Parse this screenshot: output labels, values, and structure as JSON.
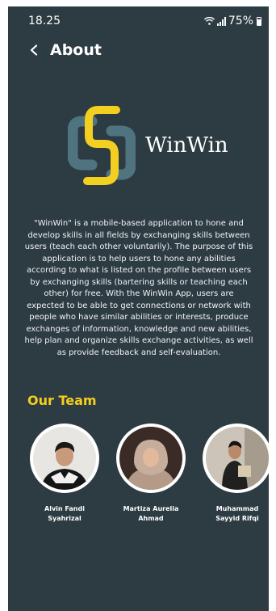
{
  "status": {
    "time": "18.25",
    "battery": "75%"
  },
  "header": {
    "title": "About"
  },
  "brand": {
    "name": "WinWin",
    "colors": {
      "yellow": "#f2cf20",
      "teal": "#4f7480",
      "background": "#2d3b43"
    }
  },
  "about": {
    "text": "\"WinWin\" is a mobile-based application to hone and develop skills in all fields by exchanging skills between users (teach each other voluntarily). The purpose of this application is to help users to hone any abilities according to what is listed on the profile between users by exchanging skills (bartering skills or teaching each other) for free. With the WinWin App, users are expected to be able to get connections or network with people who have similar abilities or interests, produce exchanges of information, knowledge and new abilities, help plan and organize skills exchange activities, as well as provide feedback and self-evaluation."
  },
  "team": {
    "title": "Our Team",
    "members": [
      {
        "name_line1": "Alvin Fandi",
        "name_line2": "Syahrizal"
      },
      {
        "name_line1": "Martiza Aurelia",
        "name_line2": "Ahmad"
      },
      {
        "name_line1": "Muhammad",
        "name_line2": "Sayyid Rifqi"
      }
    ]
  }
}
